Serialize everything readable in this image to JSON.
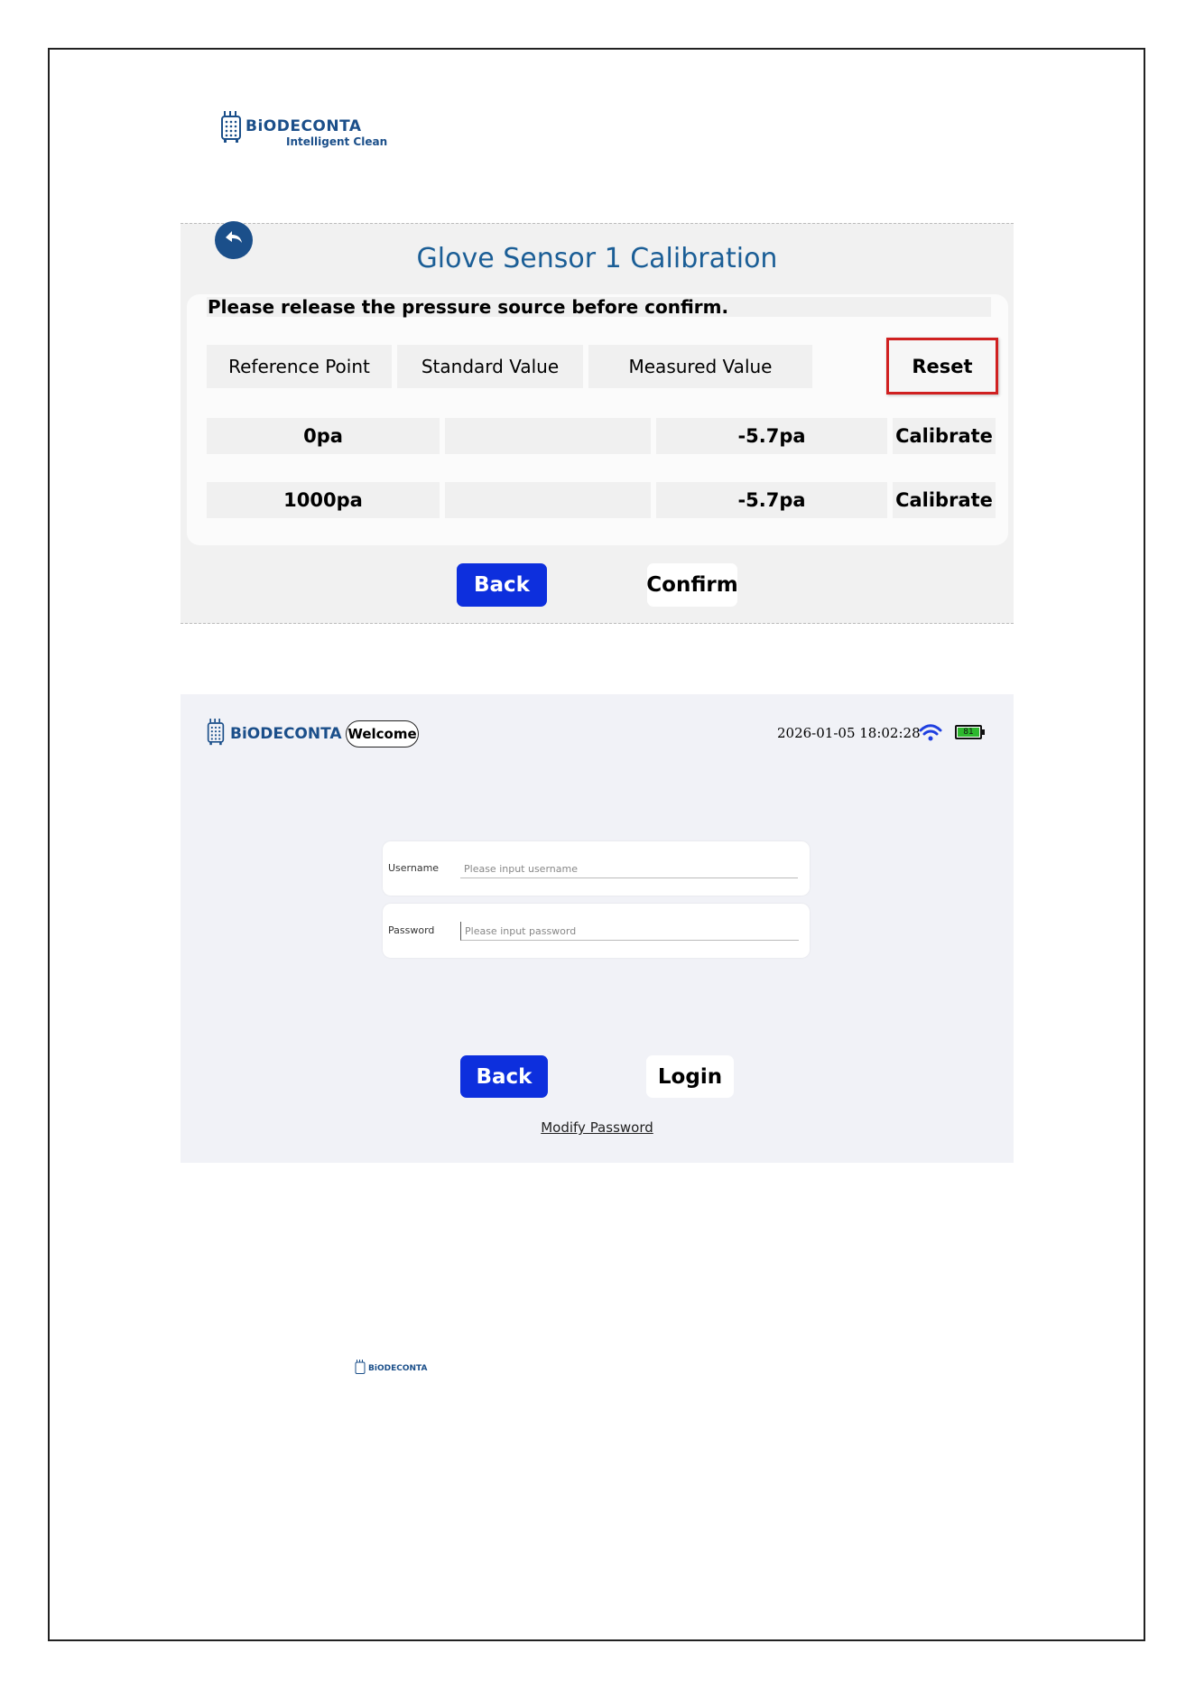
{
  "header_logo": {
    "brand": "BiODECONTA",
    "tagline": "Intelligent Clean"
  },
  "calibration": {
    "title": "Glove Sensor 1 Calibration",
    "notice": "Please release the pressure source before confirm.",
    "headers": [
      "Reference Point",
      "Standard Value",
      "Measured Value"
    ],
    "reset_label": "Reset",
    "rows": [
      {
        "reference": "0pa",
        "standard": "",
        "measured": "-5.7pa",
        "action": "Calibrate"
      },
      {
        "reference": "1000pa",
        "standard": "",
        "measured": "-5.7pa",
        "action": "Calibrate"
      }
    ],
    "back_label": "Back",
    "confirm_label": "Confirm"
  },
  "login": {
    "brand": "BiODECONTA",
    "welcome": "Welcome",
    "datetime": "2026-01-05 18:02:28",
    "battery_level": "81",
    "username_label": "Username",
    "username_placeholder": "Please input username",
    "password_label": "Password",
    "password_placeholder": "Please input password",
    "back_label": "Back",
    "login_label": "Login",
    "modify_password_label": "Modify Password"
  },
  "footer_logo": {
    "brand": "BiODECONTA"
  }
}
